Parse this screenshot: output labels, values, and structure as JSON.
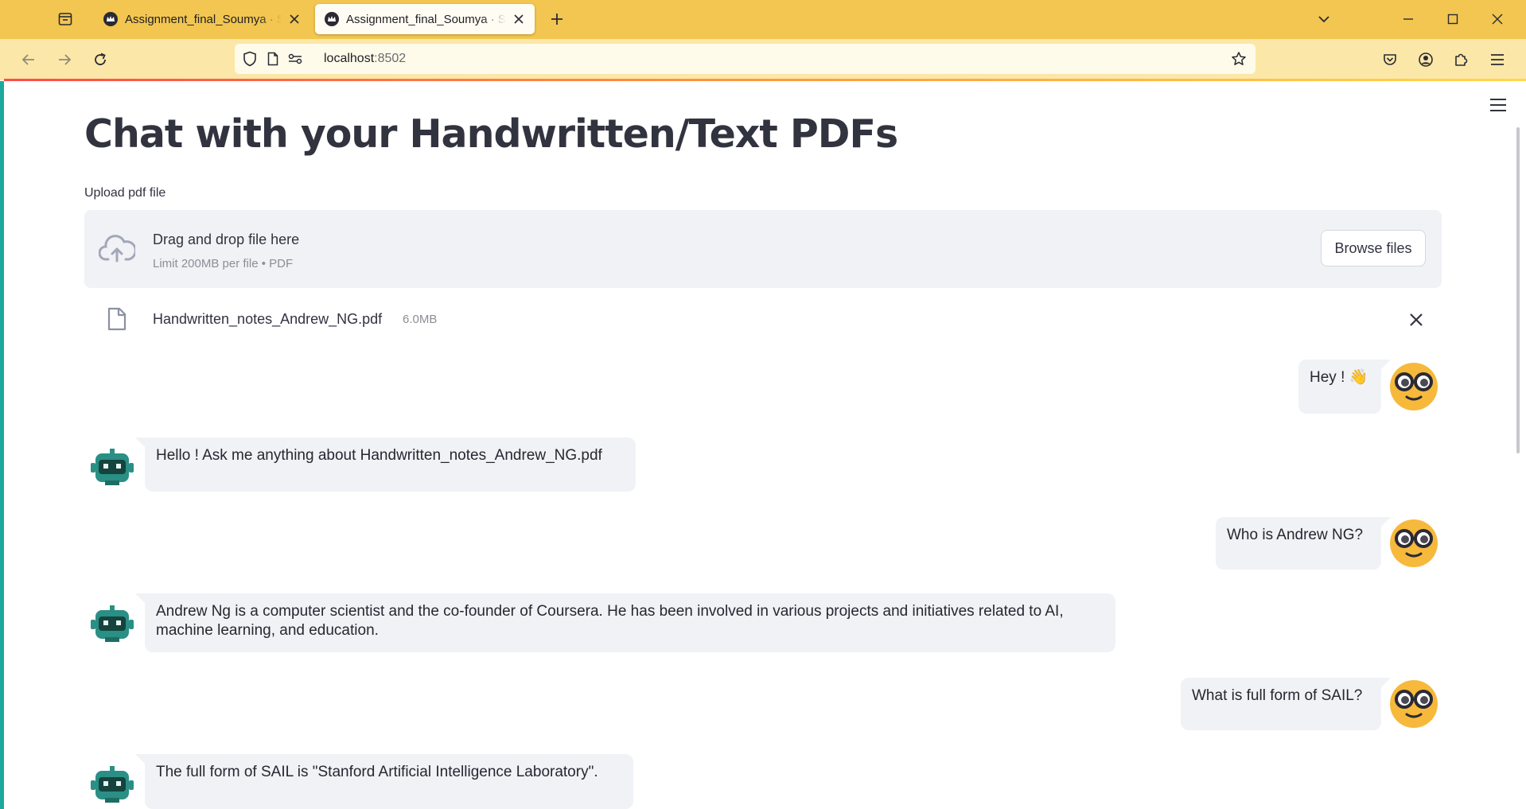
{
  "browser": {
    "tabs": [
      {
        "title": "Assignment_final_Soumya · Stre",
        "active": false
      },
      {
        "title": "Assignment_final_Soumya · Stre",
        "active": true
      }
    ],
    "url_host": "localhost",
    "url_port": ":8502",
    "accent_color": "#f2c650"
  },
  "app": {
    "title": "Chat with your Handwritten/Text PDFs",
    "uploader": {
      "label": "Upload pdf file",
      "drop_text": "Drag and drop file here",
      "limit_text": "Limit 200MB per file • PDF",
      "browse_label": "Browse files"
    },
    "uploaded_file": {
      "name": "Handwritten_notes_Andrew_NG.pdf",
      "size": "6.0MB"
    }
  },
  "chat": {
    "messages": [
      {
        "role": "user",
        "text": "Hey ! 👋"
      },
      {
        "role": "assistant",
        "text": "Hello ! Ask me anything about Handwritten_notes_Andrew_NG.pdf"
      },
      {
        "role": "user",
        "text": "Who is Andrew NG?"
      },
      {
        "role": "assistant",
        "text": "Andrew Ng is a computer scientist and the co-founder of Coursera. He has been involved in various projects and initiatives related to AI, machine learning, and education."
      },
      {
        "role": "user",
        "text": "What is full form of SAIL?"
      },
      {
        "role": "assistant",
        "text": "The full form of SAIL is \"Stanford Artificial Intelligence Laboratory\"."
      }
    ]
  },
  "icons": {
    "user_avatar": "nerd-glasses-face-icon",
    "bot_avatar": "robot-icon",
    "upload": "cloud-upload-icon",
    "file": "file-icon"
  }
}
